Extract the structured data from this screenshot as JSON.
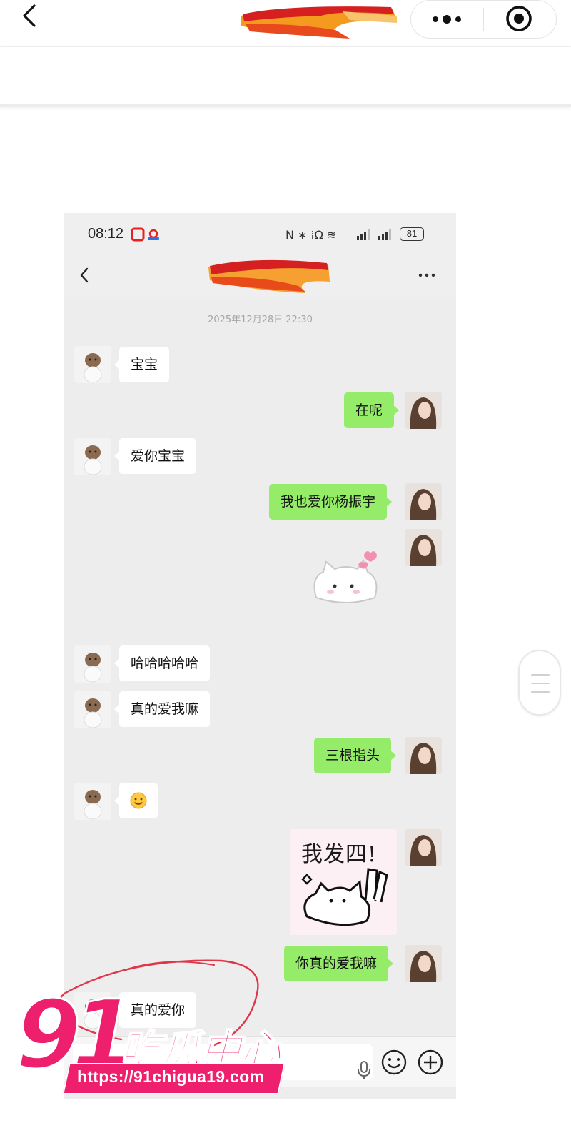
{
  "mini_program": {
    "more_icon": "more-dots-icon",
    "close_icon": "target-close-icon"
  },
  "phone": {
    "status": {
      "time": "08:12",
      "battery": "81"
    },
    "chat": {
      "timestamp": "2025年12月28日 22:30",
      "messages": [
        {
          "from": "them",
          "type": "text",
          "text": "宝宝"
        },
        {
          "from": "me",
          "type": "text",
          "text": "在呢"
        },
        {
          "from": "them",
          "type": "text",
          "text": "爱你宝宝"
        },
        {
          "from": "me",
          "type": "text",
          "text": "我也爱你杨振宇"
        },
        {
          "from": "me",
          "type": "sticker",
          "sticker": "white-cat-heart-sticker"
        },
        {
          "from": "them",
          "type": "text",
          "text": "哈哈哈哈哈"
        },
        {
          "from": "them",
          "type": "text",
          "text": "真的爱我嘛"
        },
        {
          "from": "me",
          "type": "text",
          "text": "三根指头"
        },
        {
          "from": "them",
          "type": "emoji",
          "emoji": "smile-emoji"
        },
        {
          "from": "me",
          "type": "sticker",
          "sticker_text": "我发四!"
        },
        {
          "from": "me",
          "type": "text",
          "text": "你真的爱我嘛"
        },
        {
          "from": "them",
          "type": "text",
          "text": "真的爱你"
        }
      ]
    }
  },
  "watermark": {
    "number": "91",
    "title": "吃瓜中心",
    "url": "https://91chigua19.com"
  },
  "colors": {
    "chat_background": "#ededed",
    "outgoing_bubble": "#95ec69",
    "incoming_bubble": "#ffffff",
    "watermark": "#ee1f6c",
    "annotation_circle": "#e0364a"
  }
}
